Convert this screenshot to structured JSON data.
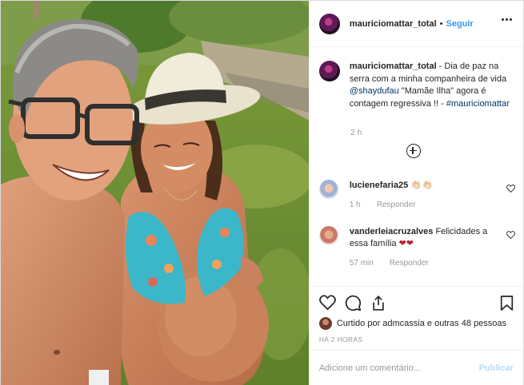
{
  "post": {
    "username": "mauriciomattar_total",
    "separator": "•",
    "follow_label": "Seguir",
    "more_icon": "more-horizontal-icon"
  },
  "caption": {
    "username": "mauriciomattar_total",
    "text_before_mention": " - Dia de paz na serra com a minha companheira de vida ",
    "mention": "@shaydufau",
    "text_after_mention": " \"Mamãe Ilha\" agora é contagem regressiva !! - ",
    "hashtag": "#mauriciomattar",
    "time": "2 h"
  },
  "load_more_icon": "plus-circle-icon",
  "comments": [
    {
      "username": "lucienefaria25",
      "text": "",
      "emoji": "👏🏻👏🏻",
      "time": "1 h",
      "reply_label": "Responder"
    },
    {
      "username": "vanderleiacruzalves",
      "text": " Felicidades a essa família ",
      "emoji": "❤❤",
      "time": "57 min",
      "reply_label": "Responder"
    }
  ],
  "actions": {
    "like_icon": "heart-icon",
    "comment_icon": "comment-icon",
    "share_icon": "share-icon",
    "save_icon": "bookmark-icon"
  },
  "likes": {
    "text": "Curtido por admcassia e outras 48 pessoas"
  },
  "posted_ago": "HÁ 2 HORAS",
  "comment_box": {
    "placeholder": "Adicione um comentário...",
    "publish_label": "Publicar"
  },
  "colors": {
    "link_blue": "#3897f0",
    "mention": "#003569",
    "heart_red": "#c0202c"
  }
}
